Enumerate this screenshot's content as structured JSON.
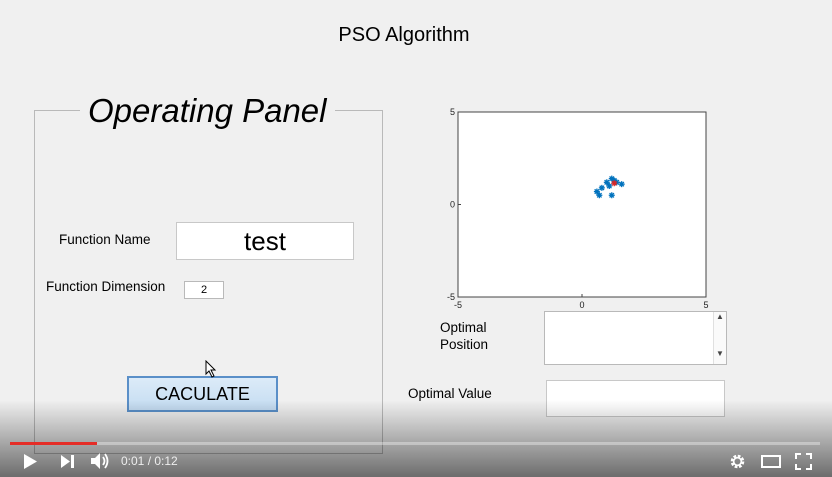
{
  "app": {
    "title": "PSO Algorithm"
  },
  "panel": {
    "title": "Operating Panel",
    "function_name_label": "Function Name",
    "function_name_value": "test",
    "function_dimension_label": "Function Dimension",
    "function_dimension_value": "2",
    "calculate_label": "CACULATE"
  },
  "plot": {
    "x_ticks": [
      "-5",
      "0",
      "5"
    ],
    "y_ticks": [
      "5",
      "0",
      "-5"
    ],
    "xlim": [
      -5,
      5
    ],
    "ylim": [
      -5,
      5
    ],
    "particles": [
      [
        1.0,
        1.2
      ],
      [
        1.2,
        1.4
      ],
      [
        1.4,
        1.2
      ],
      [
        0.8,
        0.9
      ],
      [
        1.1,
        1.0
      ],
      [
        0.6,
        0.7
      ],
      [
        1.3,
        1.3
      ],
      [
        1.6,
        1.1
      ],
      [
        1.2,
        0.5
      ],
      [
        0.7,
        0.5
      ]
    ],
    "best": [
      1.3,
      1.15
    ],
    "colors": {
      "particle": "#0072bd",
      "best": "#d62728"
    }
  },
  "results": {
    "optimal_position_label_line1": "Optimal",
    "optimal_position_label_line2": "Position",
    "optimal_value_label": "Optimal Value"
  },
  "player": {
    "time": "0:01 / 0:12",
    "progress": 0.107,
    "icons": [
      "play-icon",
      "next-icon",
      "volume-icon",
      "settings-icon",
      "theater-mode-icon",
      "fullscreen-icon"
    ],
    "accent": "#e52d27"
  }
}
